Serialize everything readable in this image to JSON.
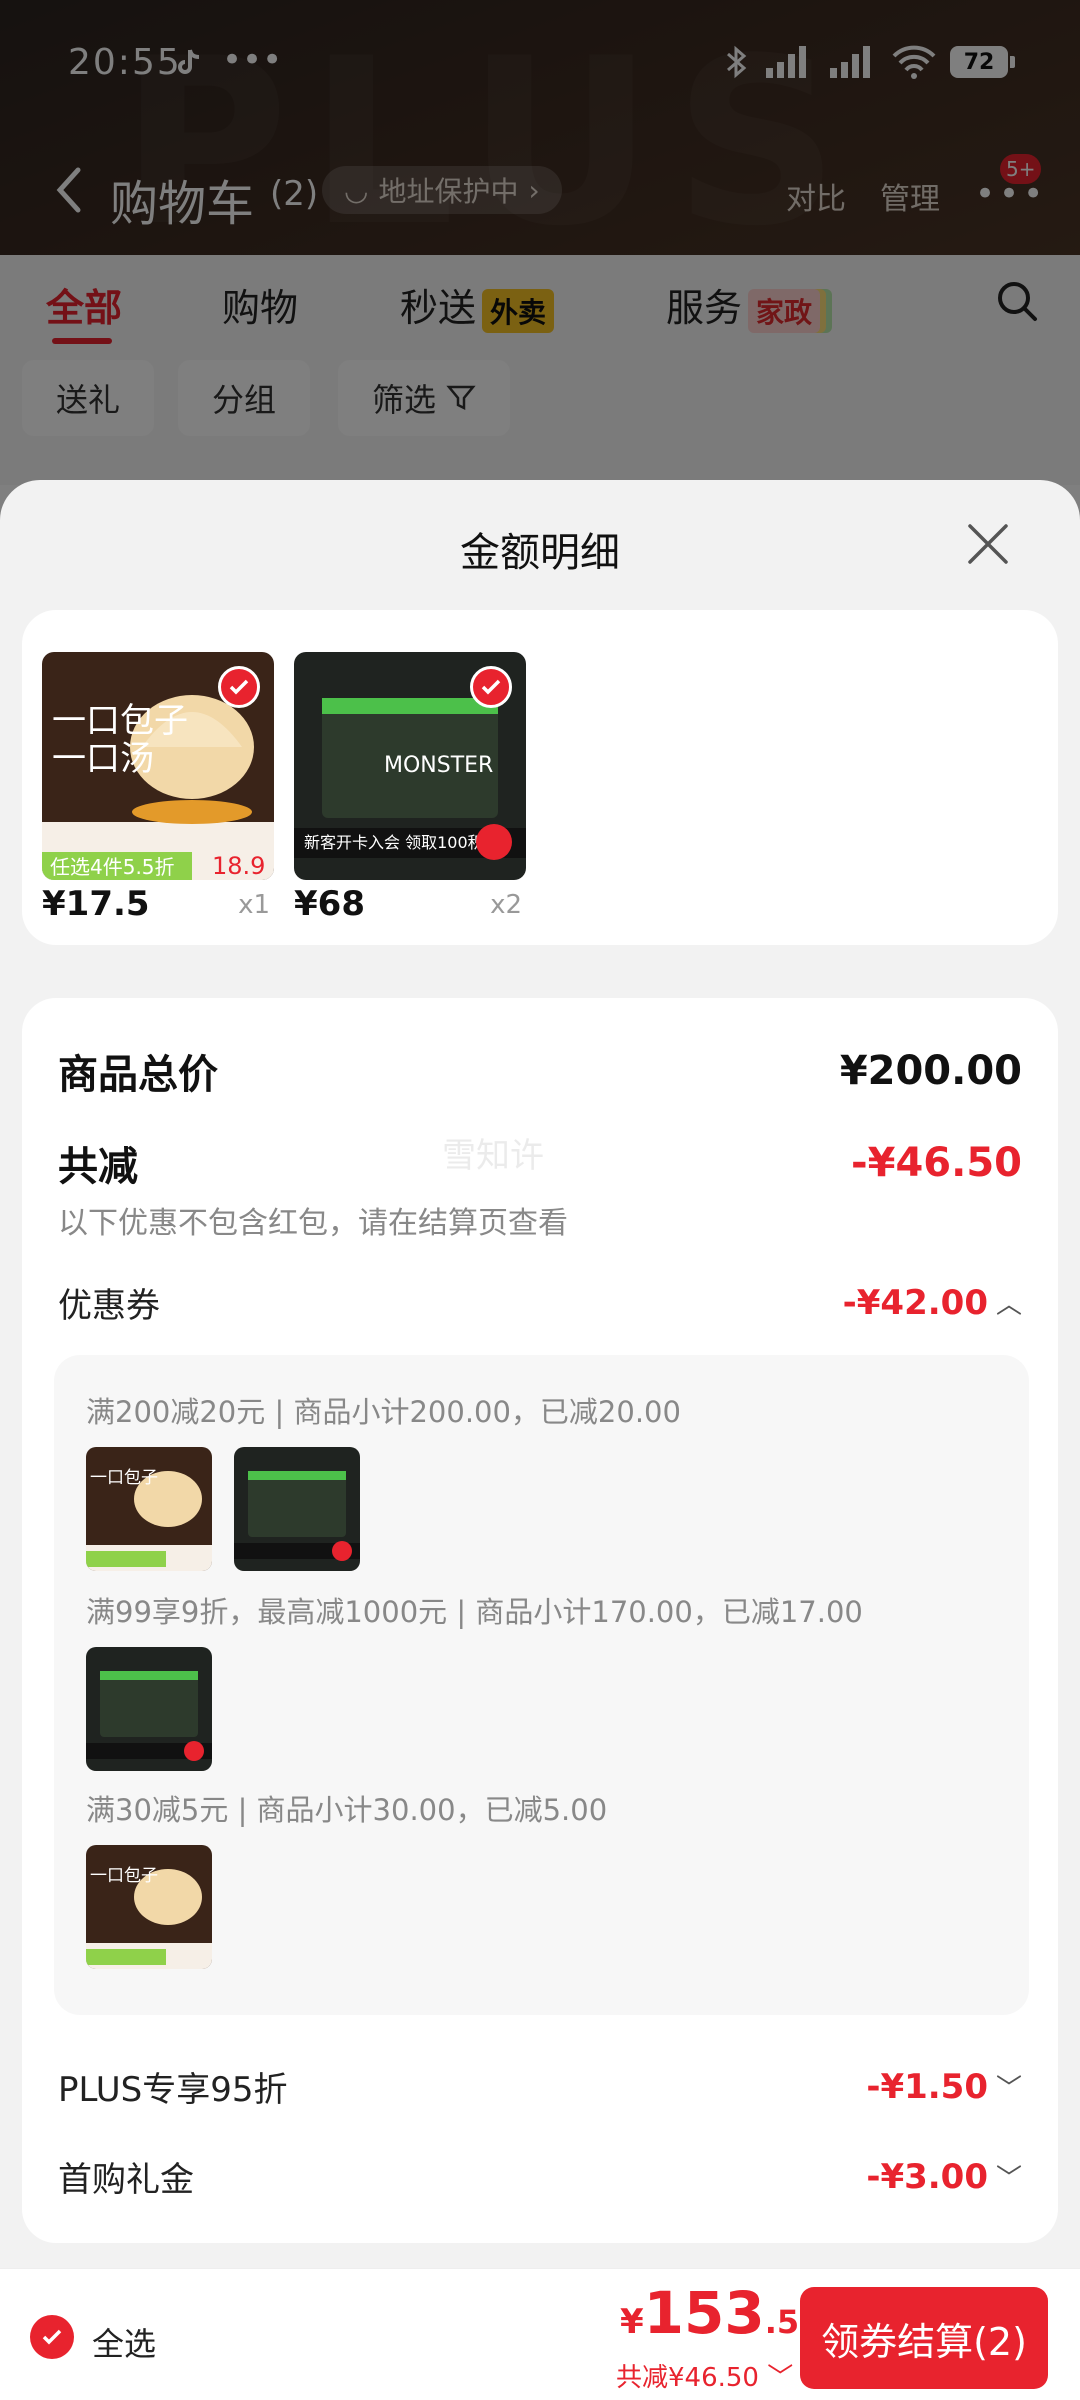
{
  "status": {
    "time": "20:55",
    "battery": "72"
  },
  "header": {
    "title": "购物车",
    "count": "(2)",
    "address_protect": "地址保护中",
    "compare": "对比",
    "manage": "管理",
    "more_badge": "5+"
  },
  "tabs": [
    {
      "label": "全部"
    },
    {
      "label": "购物"
    },
    {
      "label": "秒送",
      "tag": "外卖"
    },
    {
      "label": "服务",
      "tag": "家政"
    }
  ],
  "chips": [
    "送礼",
    "分组",
    "筛选"
  ],
  "sheet": {
    "title": "金额明细",
    "products": [
      {
        "price": "¥17.5",
        "qty": "x1"
      },
      {
        "price": "¥68",
        "qty": "x2"
      }
    ],
    "total_label": "商品总价",
    "total_value": "¥200.00",
    "discount_label": "共减",
    "discount_value": "-¥46.50",
    "note": "以下优惠不包含红包，请在结算页查看",
    "watermark": "雪知许",
    "coupon_label": "优惠券",
    "coupon_value": "-¥42.00",
    "coupons": [
      "满200减20元 | 商品小计200.00，已减20.00",
      "满99享9折，最高减1000元 | 商品小计170.00，已减17.00",
      "满30减5元 | 商品小计30.00，已减5.00"
    ],
    "plus_label": "PLUS专享95折",
    "plus_value": "-¥1.50",
    "first_label": "首购礼金",
    "first_value": "-¥3.00"
  },
  "bottom": {
    "select_all": "全选",
    "currency": "¥",
    "price_int": "153",
    "price_dec": ".50",
    "saved": "共减¥46.50",
    "checkout": "领券结算(2)"
  }
}
